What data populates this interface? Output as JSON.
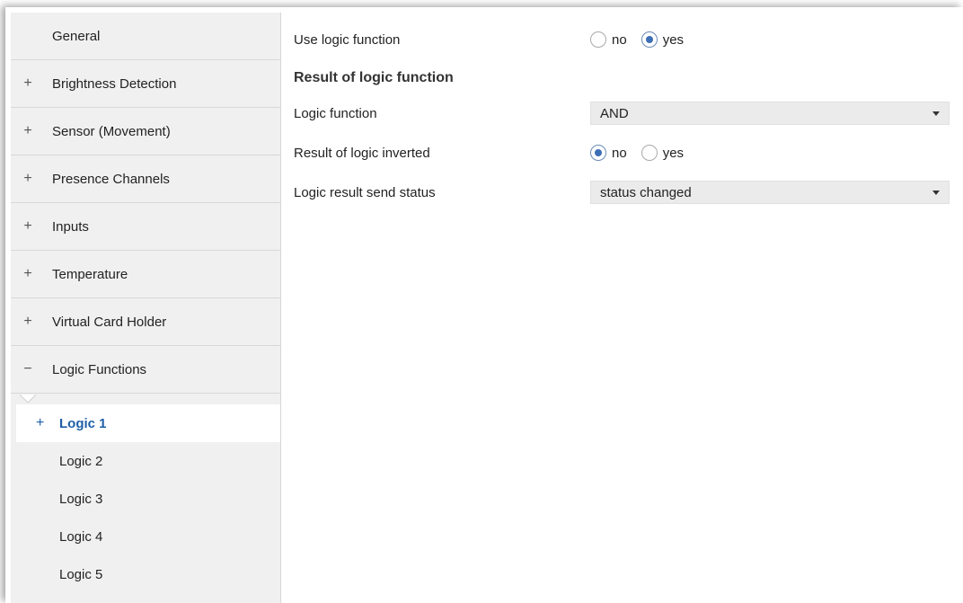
{
  "sidebar": {
    "items": [
      {
        "sign": "",
        "label": "General"
      },
      {
        "sign": "+",
        "label": "Brightness Detection"
      },
      {
        "sign": "+",
        "label": "Sensor (Movement)"
      },
      {
        "sign": "+",
        "label": "Presence Channels"
      },
      {
        "sign": "+",
        "label": "Inputs"
      },
      {
        "sign": "+",
        "label": "Temperature"
      },
      {
        "sign": "+",
        "label": "Virtual Card Holder"
      },
      {
        "sign": "−",
        "label": "Logic Functions"
      }
    ],
    "sub_items": [
      {
        "sign": "+",
        "label": "Logic 1",
        "active": true
      },
      {
        "label": "Logic 2"
      },
      {
        "label": "Logic 3"
      },
      {
        "label": "Logic 4"
      },
      {
        "label": "Logic 5"
      }
    ]
  },
  "main": {
    "use_logic": {
      "label": "Use logic function",
      "options": [
        "no",
        "yes"
      ],
      "selected": "yes"
    },
    "section_title": "Result of logic function",
    "logic_function": {
      "label": "Logic function",
      "value": "AND"
    },
    "result_inverted": {
      "label": "Result of logic inverted",
      "options": [
        "no",
        "yes"
      ],
      "selected": "no"
    },
    "send_status": {
      "label": "Logic result send status",
      "value": "status changed"
    }
  }
}
